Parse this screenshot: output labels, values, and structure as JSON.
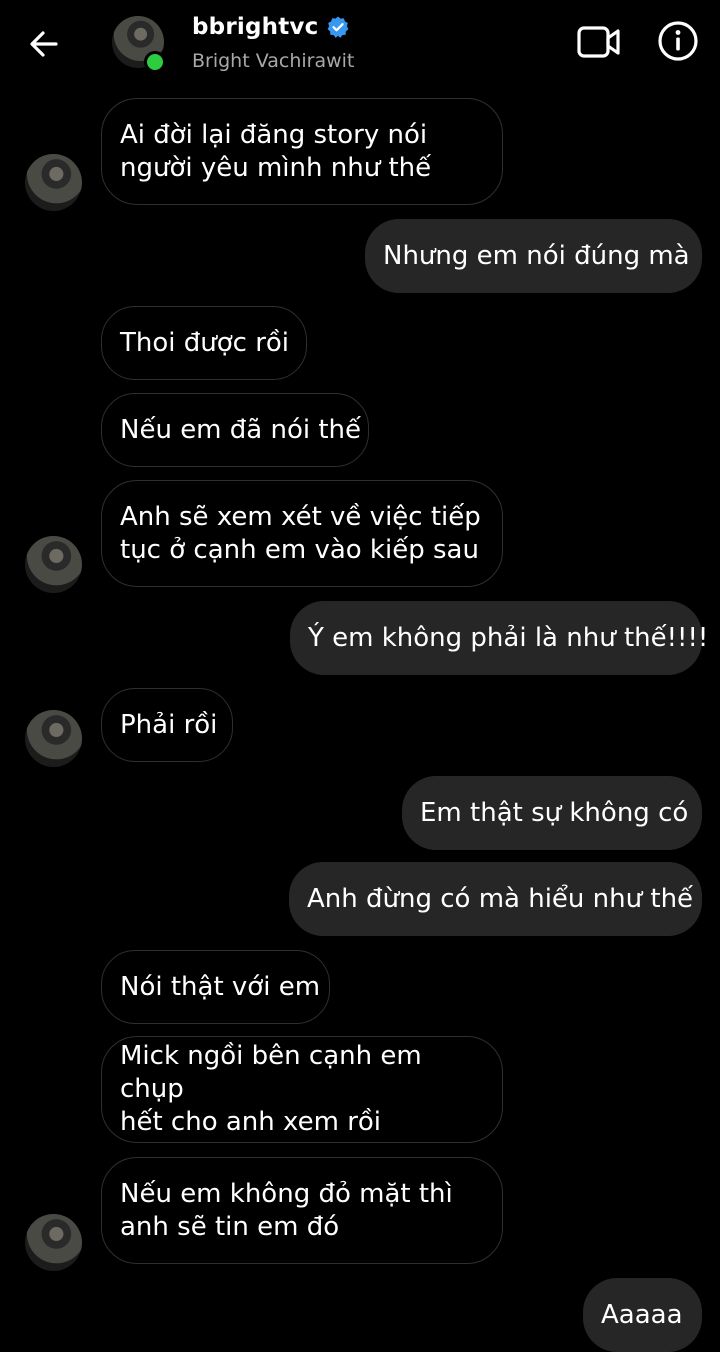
{
  "header": {
    "username": "bbrightvc",
    "display_name": "Bright Vachirawit"
  },
  "messages": [
    {
      "side": "in",
      "text": "Ai đời lại đăng story nói người yêu mình như thế",
      "lines": [
        "Ai đời lại đăng story nói",
        "người yêu mình như thế"
      ]
    },
    {
      "side": "out",
      "text": "Nhưng em nói đúng mà"
    },
    {
      "side": "in",
      "text": "Thoi được rồi"
    },
    {
      "side": "in",
      "text": "Nếu em đã nói thế"
    },
    {
      "side": "in",
      "text": "Anh sẽ xem xét về việc tiếp tục ở cạnh em vào kiếp sau",
      "lines": [
        "Anh sẽ xem xét về việc tiếp",
        "tục ở cạnh em vào kiếp sau"
      ]
    },
    {
      "side": "out",
      "text": "Ý em không phải là như thế!!!!"
    },
    {
      "side": "in",
      "text": "Phải rồi"
    },
    {
      "side": "out",
      "text": "Em thật sự không có"
    },
    {
      "side": "out",
      "text": "Anh đừng có mà hiểu như thế"
    },
    {
      "side": "in",
      "text": "Nói thật với em"
    },
    {
      "side": "in",
      "text": "Mick ngồi bên cạnh em chụp hết cho anh xem rồi",
      "lines": [
        "Mick ngồi bên cạnh em chụp",
        "hết cho anh xem rồi"
      ]
    },
    {
      "side": "in",
      "text": "Nếu em không đỏ mặt thì anh sẽ tin em đó",
      "lines": [
        "Nếu em không đỏ mặt thì",
        "anh sẽ tin em đó"
      ]
    },
    {
      "side": "out",
      "text": "Aaaaa"
    }
  ]
}
